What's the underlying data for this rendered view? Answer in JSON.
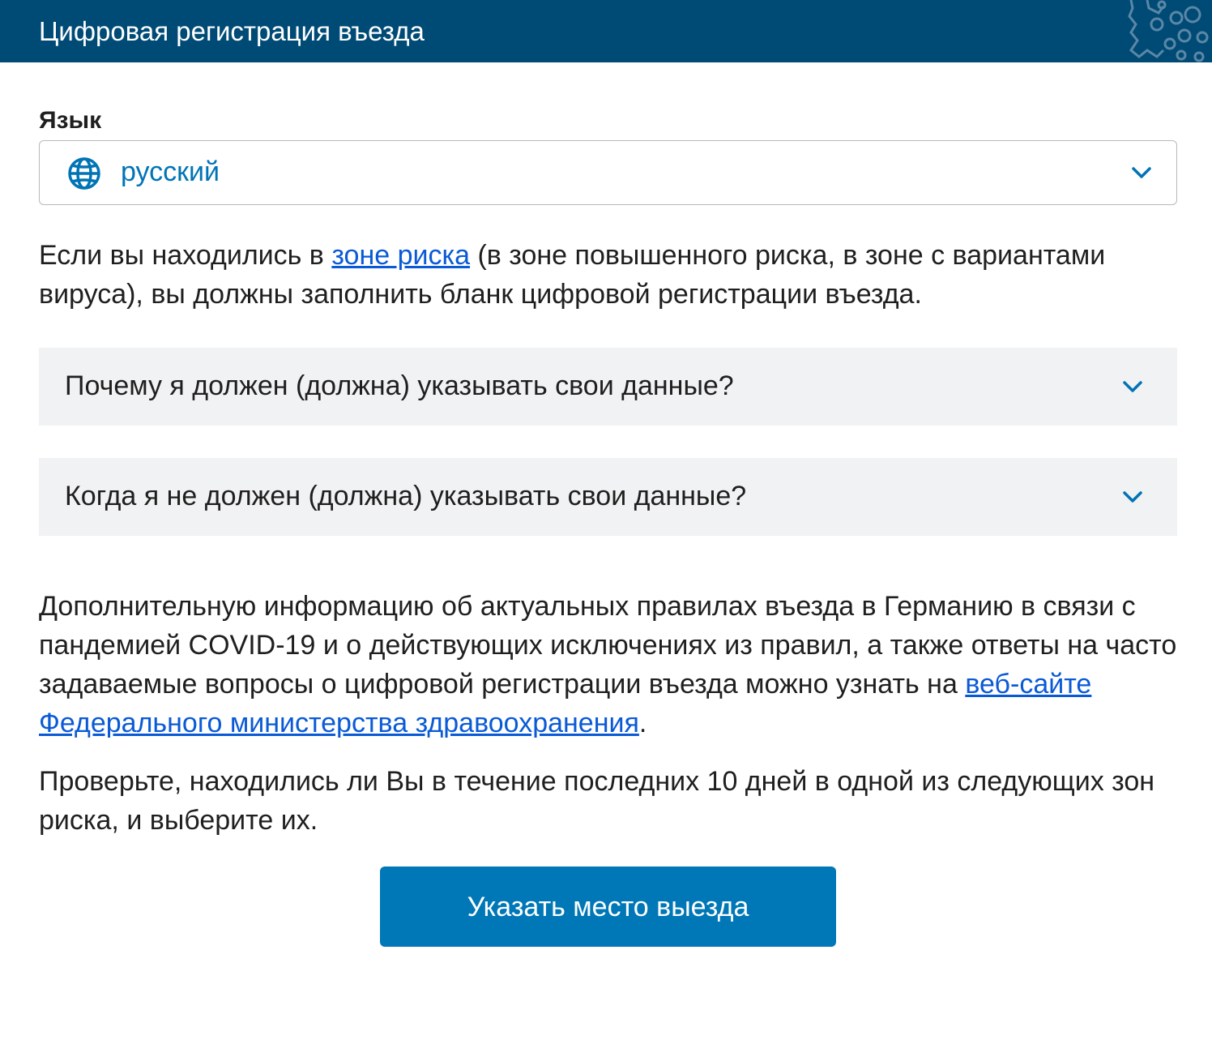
{
  "header": {
    "title": "Цифровая регистрация въезда"
  },
  "language": {
    "label": "Язык",
    "selected": "русский"
  },
  "intro": {
    "before_link": "Если вы находились в ",
    "link_text": "зоне риска",
    "after_link": " (в зоне повышенного риска, в зоне с вариантами вируса), вы должны заполнить бланк цифровой регистрации въезда."
  },
  "accordions": [
    {
      "title": "Почему я должен (должна) указывать свои данные?"
    },
    {
      "title": "Когда я не должен (должна) указывать свои данные?"
    }
  ],
  "info": {
    "before_link": "Дополнительную информацию об актуальных правилах въезда в Германию в связи с пандемией COVID-19 и о действующих исключениях из правил, а также ответы на часто задаваемые вопросы о цифровой регистрации въезда можно узнать на ",
    "link_text": "веб-сайте Федерального министерства здравоохранения",
    "after_link": "."
  },
  "check_text": "Проверьте, находились ли Вы в течение последних 10 дней в одной из следующих зон риска, и выберите их.",
  "primary_button": {
    "label": "Указать место выезда"
  },
  "colors": {
    "header_bg": "#004b76",
    "accent": "#0077b6",
    "link": "#0a5ad6",
    "accordion_bg": "#f1f2f3"
  },
  "icons": {
    "language": "globe-icon",
    "select": "chevron-down-icon",
    "accordion": "chevron-down-icon",
    "header": "virus-pattern-icon"
  }
}
